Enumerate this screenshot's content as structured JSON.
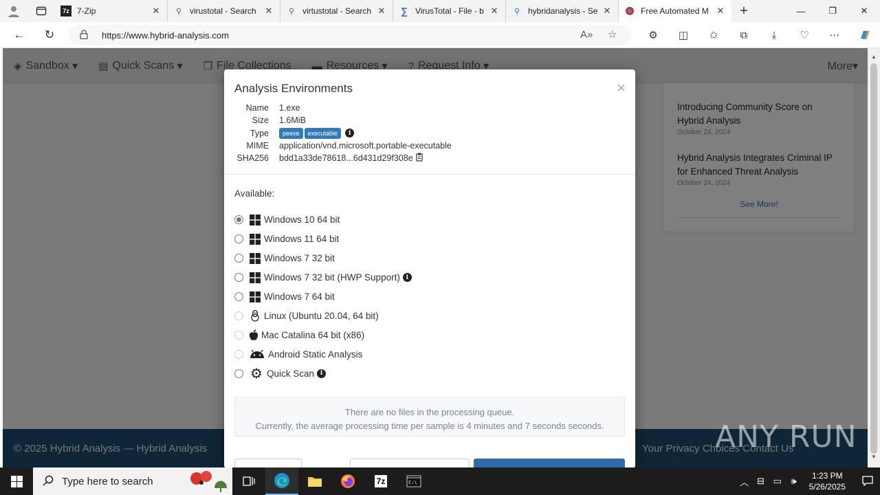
{
  "browser": {
    "tabs": [
      {
        "title": "7-Zip",
        "icon": "7zip-icon"
      },
      {
        "title": "virustotal - Search",
        "icon": "search-icon"
      },
      {
        "title": "virtustotal - Search",
        "icon": "search-icon"
      },
      {
        "title": "VirusTotal - File - b",
        "icon": "virustotal-icon"
      },
      {
        "title": "hybridanalysis - Se",
        "icon": "search-icon"
      },
      {
        "title": "Free Automated M",
        "icon": "hybrid-analysis-icon",
        "active": true
      }
    ],
    "url": "https://www.hybrid-analysis.com"
  },
  "site": {
    "nav": [
      "Sandbox",
      "Quick Scans",
      "File Collections",
      "Resources",
      "Request Info"
    ],
    "more": "More",
    "news": [
      {
        "title": "Introducing Community Score on Hybrid Analysis",
        "date": "October 24, 2024"
      },
      {
        "title": "Hybrid Analysis Integrates Criminal IP for Enhanced Threat Analysis",
        "date": "October 24, 2024"
      }
    ],
    "see_more": "See More!",
    "footer_left": "© 2025 Hybrid Analysis — Hybrid Analysis",
    "footer_right": "Your Privacy Choices  Contact Us"
  },
  "modal": {
    "title": "Analysis Environments",
    "close": "×",
    "file": {
      "name_label": "Name",
      "name": "1.exe",
      "size_label": "Size",
      "size": "1.6MiB",
      "type_label": "Type",
      "type_badges": [
        "peexe",
        "executable"
      ],
      "mime_label": "MIME",
      "mime": "application/vnd.microsoft.portable-executable",
      "sha_label": "SHA256",
      "sha256": "bdd1a33de78618...6d431d29f308e"
    },
    "available_label": "Available:",
    "environments": [
      {
        "label": "Windows 10 64 bit",
        "os": "windows",
        "checked": true
      },
      {
        "label": "Windows 11 64 bit",
        "os": "windows"
      },
      {
        "label": "Windows 7 32 bit",
        "os": "windows"
      },
      {
        "label": "Windows 7 32 bit (HWP Support)",
        "os": "windows",
        "info": true
      },
      {
        "label": "Windows 7 64 bit",
        "os": "windows"
      },
      {
        "label": "Linux (Ubuntu 20.04, 64 bit)",
        "os": "linux",
        "disabled": true
      },
      {
        "label": "Mac Catalina 64 bit (x86)",
        "os": "apple",
        "disabled": true
      },
      {
        "label": "Android Static Analysis",
        "os": "android",
        "disabled": true
      },
      {
        "label": "Quick Scan",
        "os": "gear",
        "info": true
      }
    ],
    "queue_line1": "There are no files in the processing queue.",
    "queue_line2": "Currently, the average processing time per sample is 4 minutes and 7 seconds seconds."
  },
  "watermark": "ANY RUN",
  "taskbar": {
    "search_placeholder": "Type here to search",
    "time": "1:23 PM",
    "date": "5/26/2025"
  },
  "colors": {
    "accent": "#337ab7",
    "footer": "#1f4d73",
    "taskbar": "#1c1c1c"
  }
}
